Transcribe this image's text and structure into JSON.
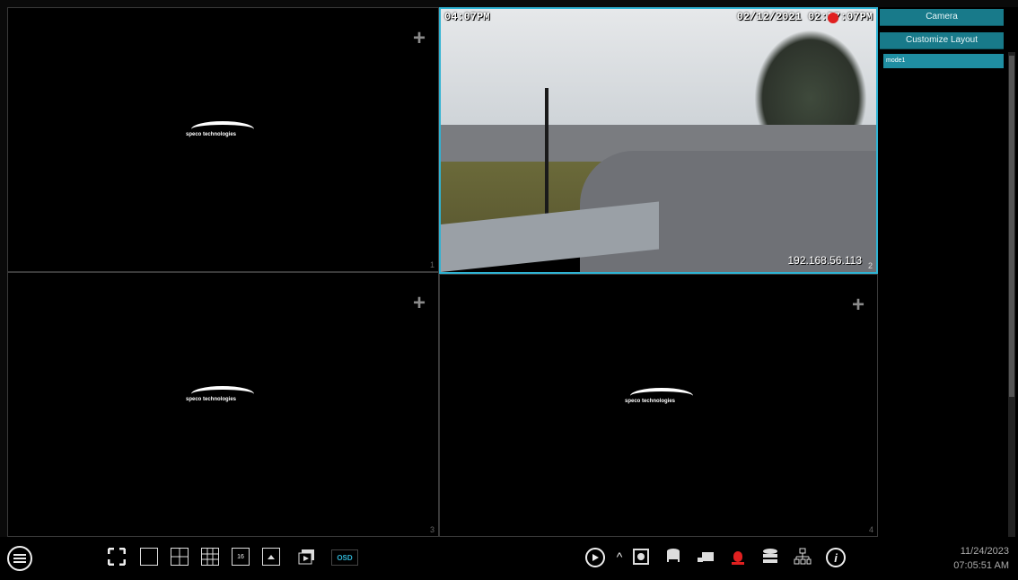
{
  "sidebar": {
    "camera_tab": "Camera",
    "customize_layout_tab": "Customize Layout",
    "modes": [
      "mode1"
    ]
  },
  "channels": [
    {
      "number": "1",
      "logo_text": "speco technologies"
    },
    {
      "number": "2",
      "osd_left": "04:07PM",
      "osd_right": "02/12/2021 02:57:07PM",
      "ip": "192.168.56.113"
    },
    {
      "number": "3",
      "logo_text": "speco technologies"
    },
    {
      "number": "4",
      "logo_text": "speco technologies"
    }
  ],
  "toolbar": {
    "osd_label": "OSD",
    "icons": [
      "menu-icon",
      "fullscreen-icon",
      "layout-1-icon",
      "layout-4-icon",
      "layout-9-icon",
      "layout-16-icon",
      "pip-icon",
      "sequence-icon",
      "playback-icon",
      "chevron-up-icon",
      "snapshot-icon",
      "record-icon",
      "camera-icon",
      "alarm-icon",
      "disk-icon",
      "network-icon",
      "info-icon"
    ]
  },
  "clock": {
    "date": "11/24/2023",
    "time": "07:05:51 AM"
  },
  "colors": {
    "accent": "#2fb3d3",
    "tab": "#187a8a",
    "alarm": "#e02020"
  }
}
